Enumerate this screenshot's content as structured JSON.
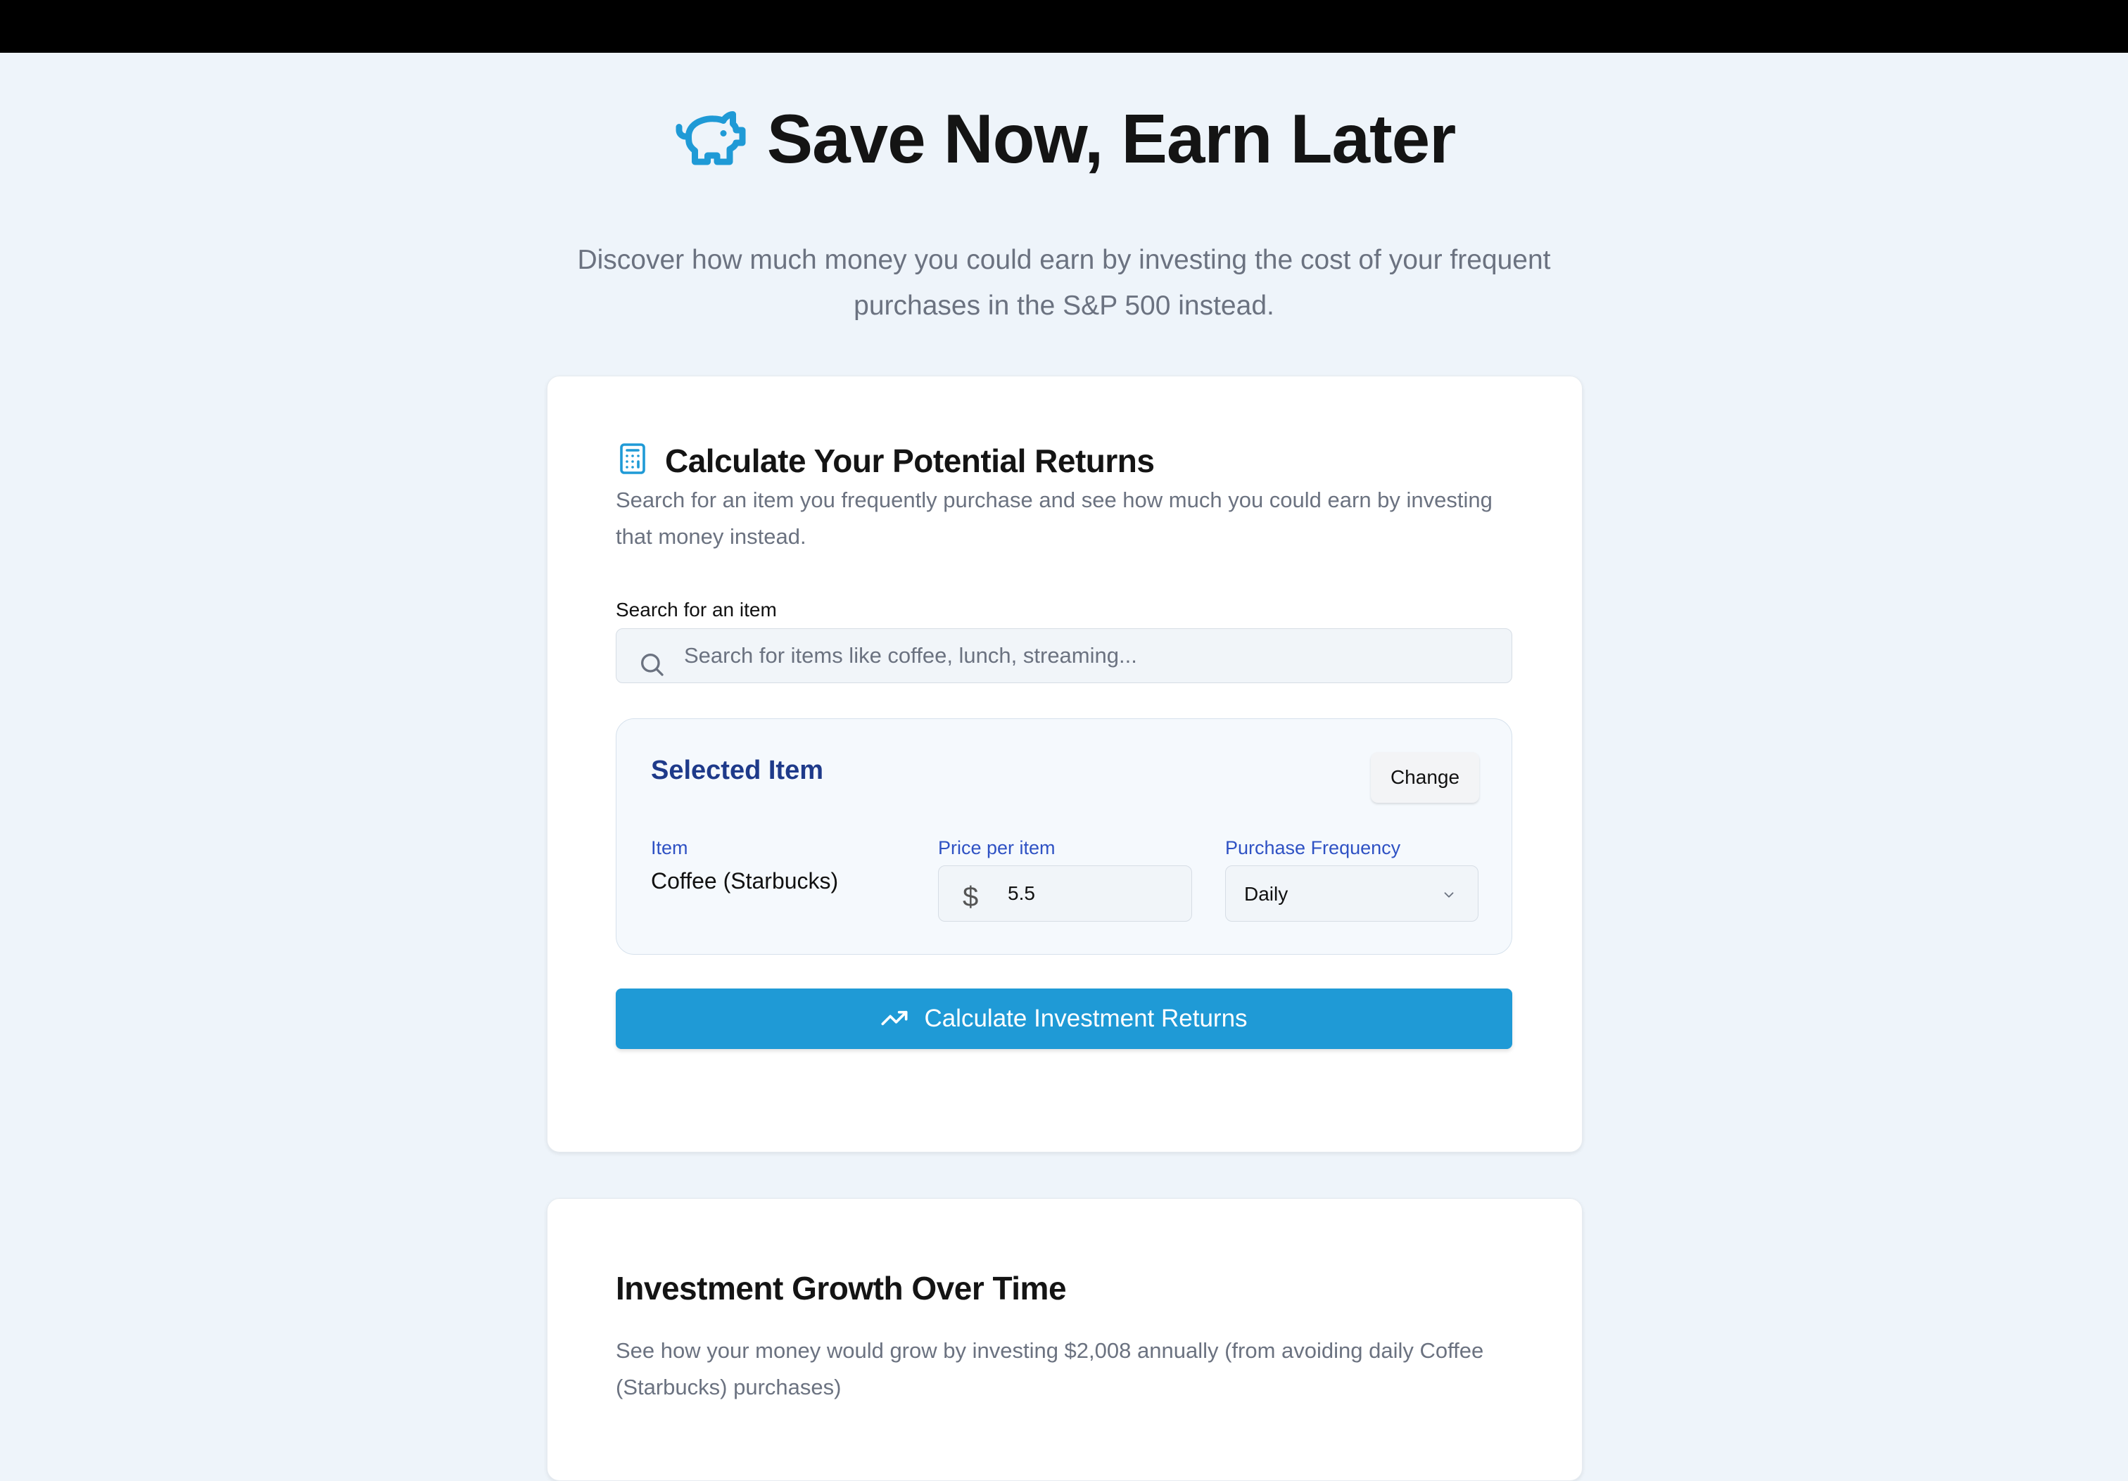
{
  "header": {
    "title": "Save Now, Earn Later",
    "subtitle": "Discover how much money you could earn by investing the cost of your frequent purchases in the S&P 500 instead.",
    "logo_icon": "piggy-bank-icon"
  },
  "calculator": {
    "title": "Calculate Your Potential Returns",
    "title_icon": "calculator-icon",
    "description": "Search for an item you frequently purchase and see how much you could earn by investing that money instead.",
    "search": {
      "label": "Search for an item",
      "placeholder": "Search for items like coffee, lunch, streaming...",
      "value": ""
    },
    "selected": {
      "title": "Selected Item",
      "change_label": "Change",
      "item_label": "Item",
      "item_value": "Coffee (Starbucks)",
      "price_label": "Price per item",
      "price_symbol": "$",
      "price_value": "5.5",
      "frequency_label": "Purchase Frequency",
      "frequency_value": "Daily"
    },
    "calculate_label": "Calculate Investment Returns"
  },
  "growth": {
    "title": "Investment Growth Over Time",
    "description": "See how your money would grow by investing $2,008 annually (from avoiding daily Coffee (Starbucks) purchases)"
  },
  "colors": {
    "accent": "#1f9ad6",
    "selected_title": "#1e3a8a",
    "field_label": "#2f52c4",
    "background": "#eef4fa"
  }
}
